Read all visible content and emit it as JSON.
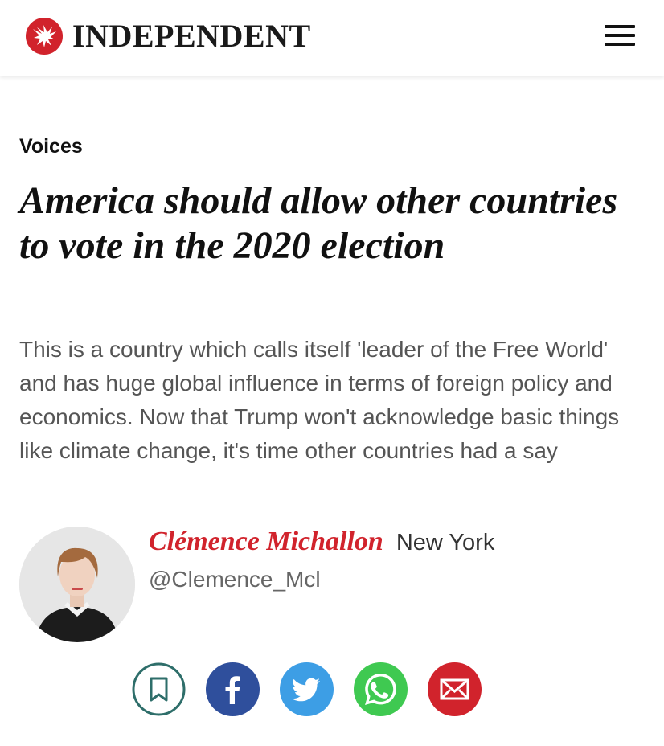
{
  "header": {
    "brand": "INDEPENDENT",
    "logo_icon": "eagle-icon",
    "menu_icon": "hamburger-icon",
    "brand_color": "#d1232c"
  },
  "article": {
    "section": "Voices",
    "headline": "America should allow other countries to vote in the 2020 election",
    "standfirst": "This is a country which calls itself 'leader of the Free World' and has huge global influence in terms of foreign policy and economics. Now that Trump won't acknowledge basic things like climate change, it's time other countries had a say"
  },
  "author": {
    "name": "Clémence Michallon",
    "location": "New York",
    "handle": "@Clemence_Mcl",
    "avatar_icon": "author-photo"
  },
  "share": [
    {
      "name": "bookmark",
      "icon": "bookmark-icon",
      "color": "#2e6e6a"
    },
    {
      "name": "facebook",
      "icon": "facebook-icon",
      "color": "#2f4f9c"
    },
    {
      "name": "twitter",
      "icon": "twitter-icon",
      "color": "#3d9ee5"
    },
    {
      "name": "whatsapp",
      "icon": "whatsapp-icon",
      "color": "#3fc951"
    },
    {
      "name": "email",
      "icon": "email-icon",
      "color": "#d1232c"
    }
  ]
}
